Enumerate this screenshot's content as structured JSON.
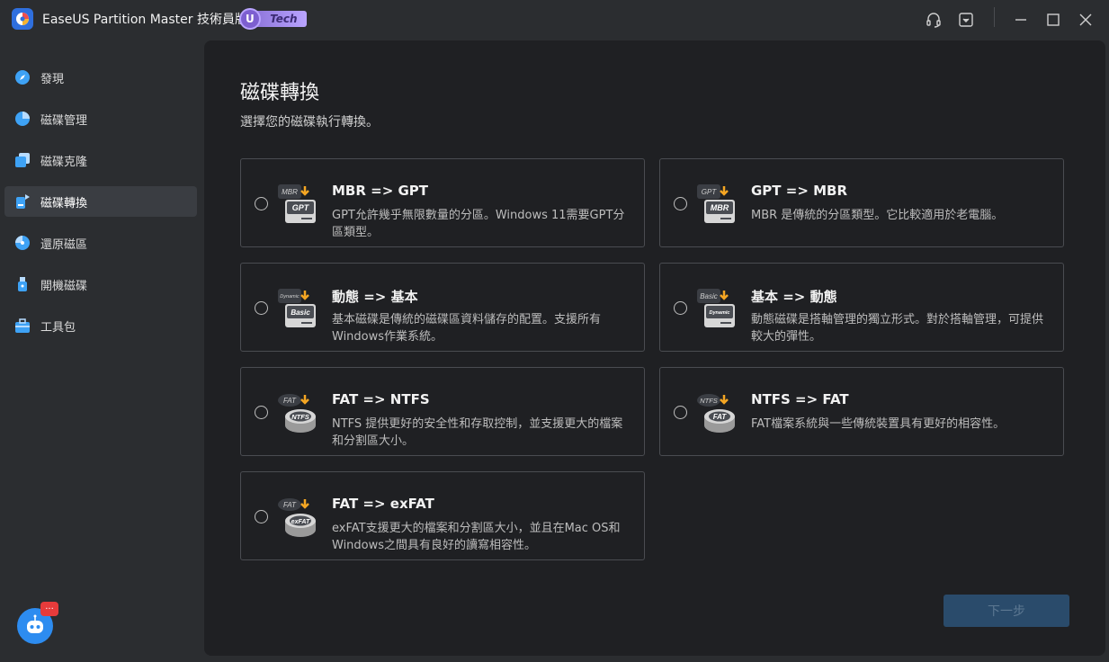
{
  "app": {
    "title": "EaseUS Partition Master 技術員版",
    "edition_letter": "U",
    "edition_label": "Tech",
    "accent": "#2d8cf0"
  },
  "titlebar_icons": [
    "headset-icon",
    "dropdown-menu-icon",
    "minimize-icon",
    "maximize-icon",
    "close-icon"
  ],
  "sidebar": {
    "items": [
      {
        "label": "發現",
        "icon": "compass-icon"
      },
      {
        "label": "磁碟管理",
        "icon": "pie-chart-icon"
      },
      {
        "label": "磁碟克隆",
        "icon": "clone-icon"
      },
      {
        "label": "磁碟轉換",
        "icon": "convert-icon"
      },
      {
        "label": "還原磁區",
        "icon": "recover-icon"
      },
      {
        "label": "開機磁碟",
        "icon": "usb-icon"
      },
      {
        "label": "工具包",
        "icon": "toolbox-icon"
      }
    ],
    "active_index": 3,
    "chat_badge": "···"
  },
  "main": {
    "title": "磁碟轉換",
    "subtitle": "選擇您的磁碟執行轉換。",
    "options": [
      {
        "from": "MBR",
        "to": "GPT",
        "title": "MBR => GPT",
        "desc": "GPT允許幾乎無限數量的分區。Windows 11需要GPT分區類型。",
        "icon": "mbr-to-gpt-disk-icon"
      },
      {
        "from": "GPT",
        "to": "MBR",
        "title": "GPT => MBR",
        "desc": "MBR 是傳統的分區類型。它比較適用於老電腦。",
        "icon": "gpt-to-mbr-disk-icon"
      },
      {
        "from": "Dynamic",
        "to": "Basic",
        "title": "動態 => 基本",
        "desc": "基本磁碟是傳統的磁碟區資料儲存的配置。支援所有Windows作業系統。",
        "icon": "dynamic-to-basic-disk-icon"
      },
      {
        "from": "Basic",
        "to": "Dynamic",
        "title": "基本 => 動態",
        "desc": "動態磁碟是搭軸管理的獨立形式。對於搭軸管理，可提供較大的彈性。",
        "icon": "basic-to-dynamic-disk-icon"
      },
      {
        "from": "FAT",
        "to": "NTFS",
        "title": "FAT => NTFS",
        "desc": "NTFS 提供更好的安全性和存取控制，並支援更大的檔案和分割區大小。",
        "icon": "fat-to-ntfs-disk-icon"
      },
      {
        "from": "NTFS",
        "to": "FAT",
        "title": "NTFS => FAT",
        "desc": "FAT檔案系統與一些傳統裝置具有更好的相容性。",
        "icon": "ntfs-to-fat-disk-icon"
      },
      {
        "from": "FAT",
        "to": "exFAT",
        "title": "FAT => exFAT",
        "desc": "exFAT支援更大的檔案和分割區大小，並且在Mac OS和Windows之間具有良好的讀寫相容性。",
        "icon": "fat-to-exfat-disk-icon"
      }
    ],
    "next_button": "下一步"
  }
}
